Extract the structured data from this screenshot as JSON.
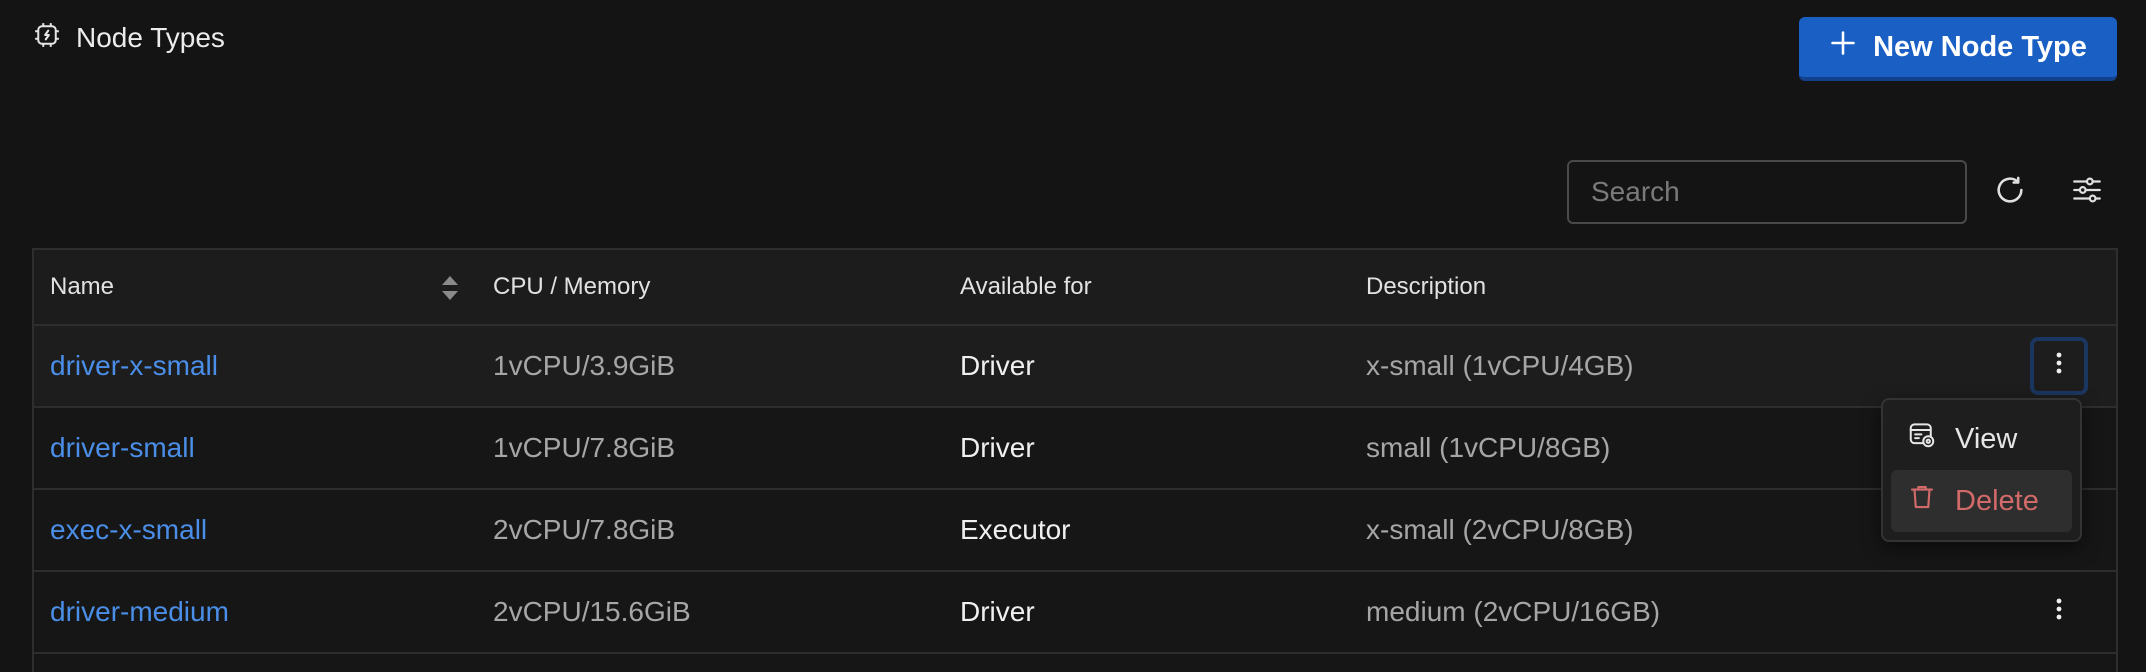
{
  "header": {
    "title": "Node Types",
    "title_icon": "cpu-chip-icon",
    "new_button_label": "New Node Type",
    "new_button_icon": "plus-icon"
  },
  "toolbar": {
    "search_placeholder": "Search",
    "search_value": "",
    "refresh_icon": "refresh-icon",
    "filter_icon": "sliders-icon"
  },
  "table": {
    "columns": [
      "Name",
      "CPU / Memory",
      "Available for",
      "Description"
    ],
    "sortable_column": "Name",
    "rows": [
      {
        "name": "driver-x-small",
        "cpu_memory": "1vCPU/3.9GiB",
        "available_for": "Driver",
        "description": "x-small (1vCPU/4GB)"
      },
      {
        "name": "driver-small",
        "cpu_memory": "1vCPU/7.8GiB",
        "available_for": "Driver",
        "description": "small (1vCPU/8GB)"
      },
      {
        "name": "exec-x-small",
        "cpu_memory": "2vCPU/7.8GiB",
        "available_for": "Executor",
        "description": "x-small (2vCPU/8GB)"
      },
      {
        "name": "driver-medium",
        "cpu_memory": "2vCPU/15.6GiB",
        "available_for": "Driver",
        "description": "medium (2vCPU/16GB)"
      }
    ]
  },
  "context_menu": {
    "items": [
      {
        "label": "View",
        "icon": "view-icon"
      },
      {
        "label": "Delete",
        "icon": "trash-icon"
      }
    ]
  },
  "colors": {
    "background": "#141414",
    "accent": "#1a5fc4",
    "link": "#4a8ee8",
    "danger": "#d36a6a"
  }
}
